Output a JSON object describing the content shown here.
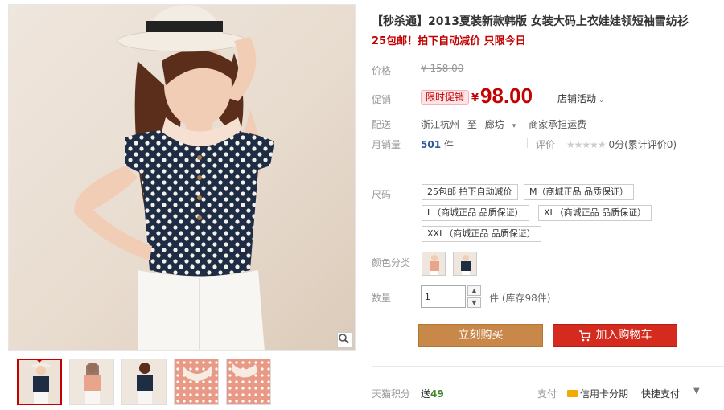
{
  "product": {
    "title": "【秒杀通】2013夏装新款韩版 女装大码上衣娃娃领短袖雪纺衫",
    "subtitle": "25包邮！拍下自动减价 只限今日"
  },
  "price_block": {
    "label": "价格",
    "original": "¥ 158.00",
    "promo_label": "促销",
    "promo_badge": "限时促销",
    "currency": "¥",
    "price": "98.00",
    "shop_activity": "店铺活动"
  },
  "shipping": {
    "label": "配送",
    "from": "浙江杭州",
    "to_word": "至",
    "to": "廊坊",
    "fee_note": "商家承担运费"
  },
  "sales": {
    "label": "月销量",
    "count": "501",
    "unit": "件",
    "rating_label": "评价",
    "stars": "★★★★★",
    "rating_text": "0分(累计评价0)"
  },
  "sizes": {
    "label": "尺码",
    "options": [
      "25包邮 拍下自动减价",
      "M（商城正品 品质保证）",
      "L（商城正品 品质保证）",
      "XL（商城正品 品质保证）",
      "XXL（商城正品 品质保证）"
    ]
  },
  "colors": {
    "label": "颜色分类"
  },
  "quantity": {
    "label": "数量",
    "value": "1",
    "stock": "件 (库存98件)"
  },
  "actions": {
    "buy_now": "立刻购买",
    "add_to_cart": "加入购物车"
  },
  "footer": {
    "points_label": "天猫积分",
    "points_prefix": "送",
    "points_value": "49",
    "pay_label": "支付",
    "credit": "信用卡分期",
    "quick_pay": "快捷支付"
  },
  "colors_theme": {
    "accent_red": "#c40000",
    "buy_button": "#c8884a",
    "cart_button": "#d52a1e"
  }
}
